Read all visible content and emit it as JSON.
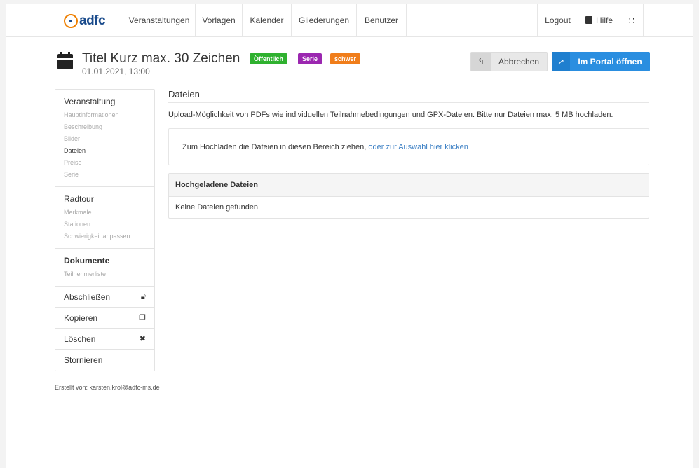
{
  "navbar": {
    "logo_text": "adfc",
    "items": [
      {
        "label": "Veranstaltungen"
      },
      {
        "label": "Vorlagen"
      },
      {
        "label": "Kalender"
      },
      {
        "label": "Gliederungen"
      },
      {
        "label": "Benutzer"
      }
    ],
    "logout_label": "Logout",
    "help_label": "Hilfe",
    "help_icon": "book-icon",
    "feed_icon": "rss-icon"
  },
  "event": {
    "title": "Titel Kurz max. 30 Zeichen",
    "date": "01.01.2021, 13:00",
    "icon": "calendar-icon",
    "badges": [
      {
        "label": "Öffentlich",
        "color": "#2fb12f"
      },
      {
        "label": "Serie",
        "color": "#9b27b0"
      },
      {
        "label": "schwer",
        "color": "#f07d1a"
      }
    ]
  },
  "actions": {
    "cancel_label": "Abbrechen",
    "cancel_icon": "reply-icon",
    "portal_label": "Im Portal öffnen",
    "portal_icon": "external-link-icon"
  },
  "sidebar": {
    "groups": [
      {
        "title": "Veranstaltung",
        "items": [
          "Hauptinformationen",
          "Beschreibung",
          "Bilder",
          "Dateien",
          "Preise",
          "Serie"
        ]
      },
      {
        "title": "Radtour",
        "items": [
          "Merkmale",
          "Stationen",
          "Schwierigkeit anpassen"
        ]
      },
      {
        "title": "Dokumente",
        "items": [
          "Teilnehmerliste"
        ]
      }
    ],
    "active_item": "Dateien",
    "actions": [
      {
        "label": "Abschließen",
        "icon": "unlock-icon"
      },
      {
        "label": "Kopieren",
        "icon": "copy-icon"
      },
      {
        "label": "Löschen",
        "icon": "times-icon"
      },
      {
        "label": "Stornieren",
        "icon": ""
      }
    ],
    "creator_text": "Erstellt von: karsten.krol@adfc-ms.de"
  },
  "main": {
    "section_title": "Dateien",
    "description": "Upload-Möglichkeit von PDFs wie individuellen Teilnahmebedingungen und GPX-Dateien. Bitte nur Dateien max. 5 MB hochladen.",
    "dropzone_text": "Zum Hochladen die Dateien in diesen Bereich ziehen,",
    "dropzone_link": "oder zur Auswahl hier klicken",
    "uploaded_title": "Hochgeladene Dateien",
    "empty_text": "Keine Dateien gefunden"
  },
  "colors": {
    "accent": "#2a8ee0",
    "link": "#3b7fc4",
    "brand_orange": "#ee7f00",
    "brand_blue": "#1a4b8c"
  }
}
